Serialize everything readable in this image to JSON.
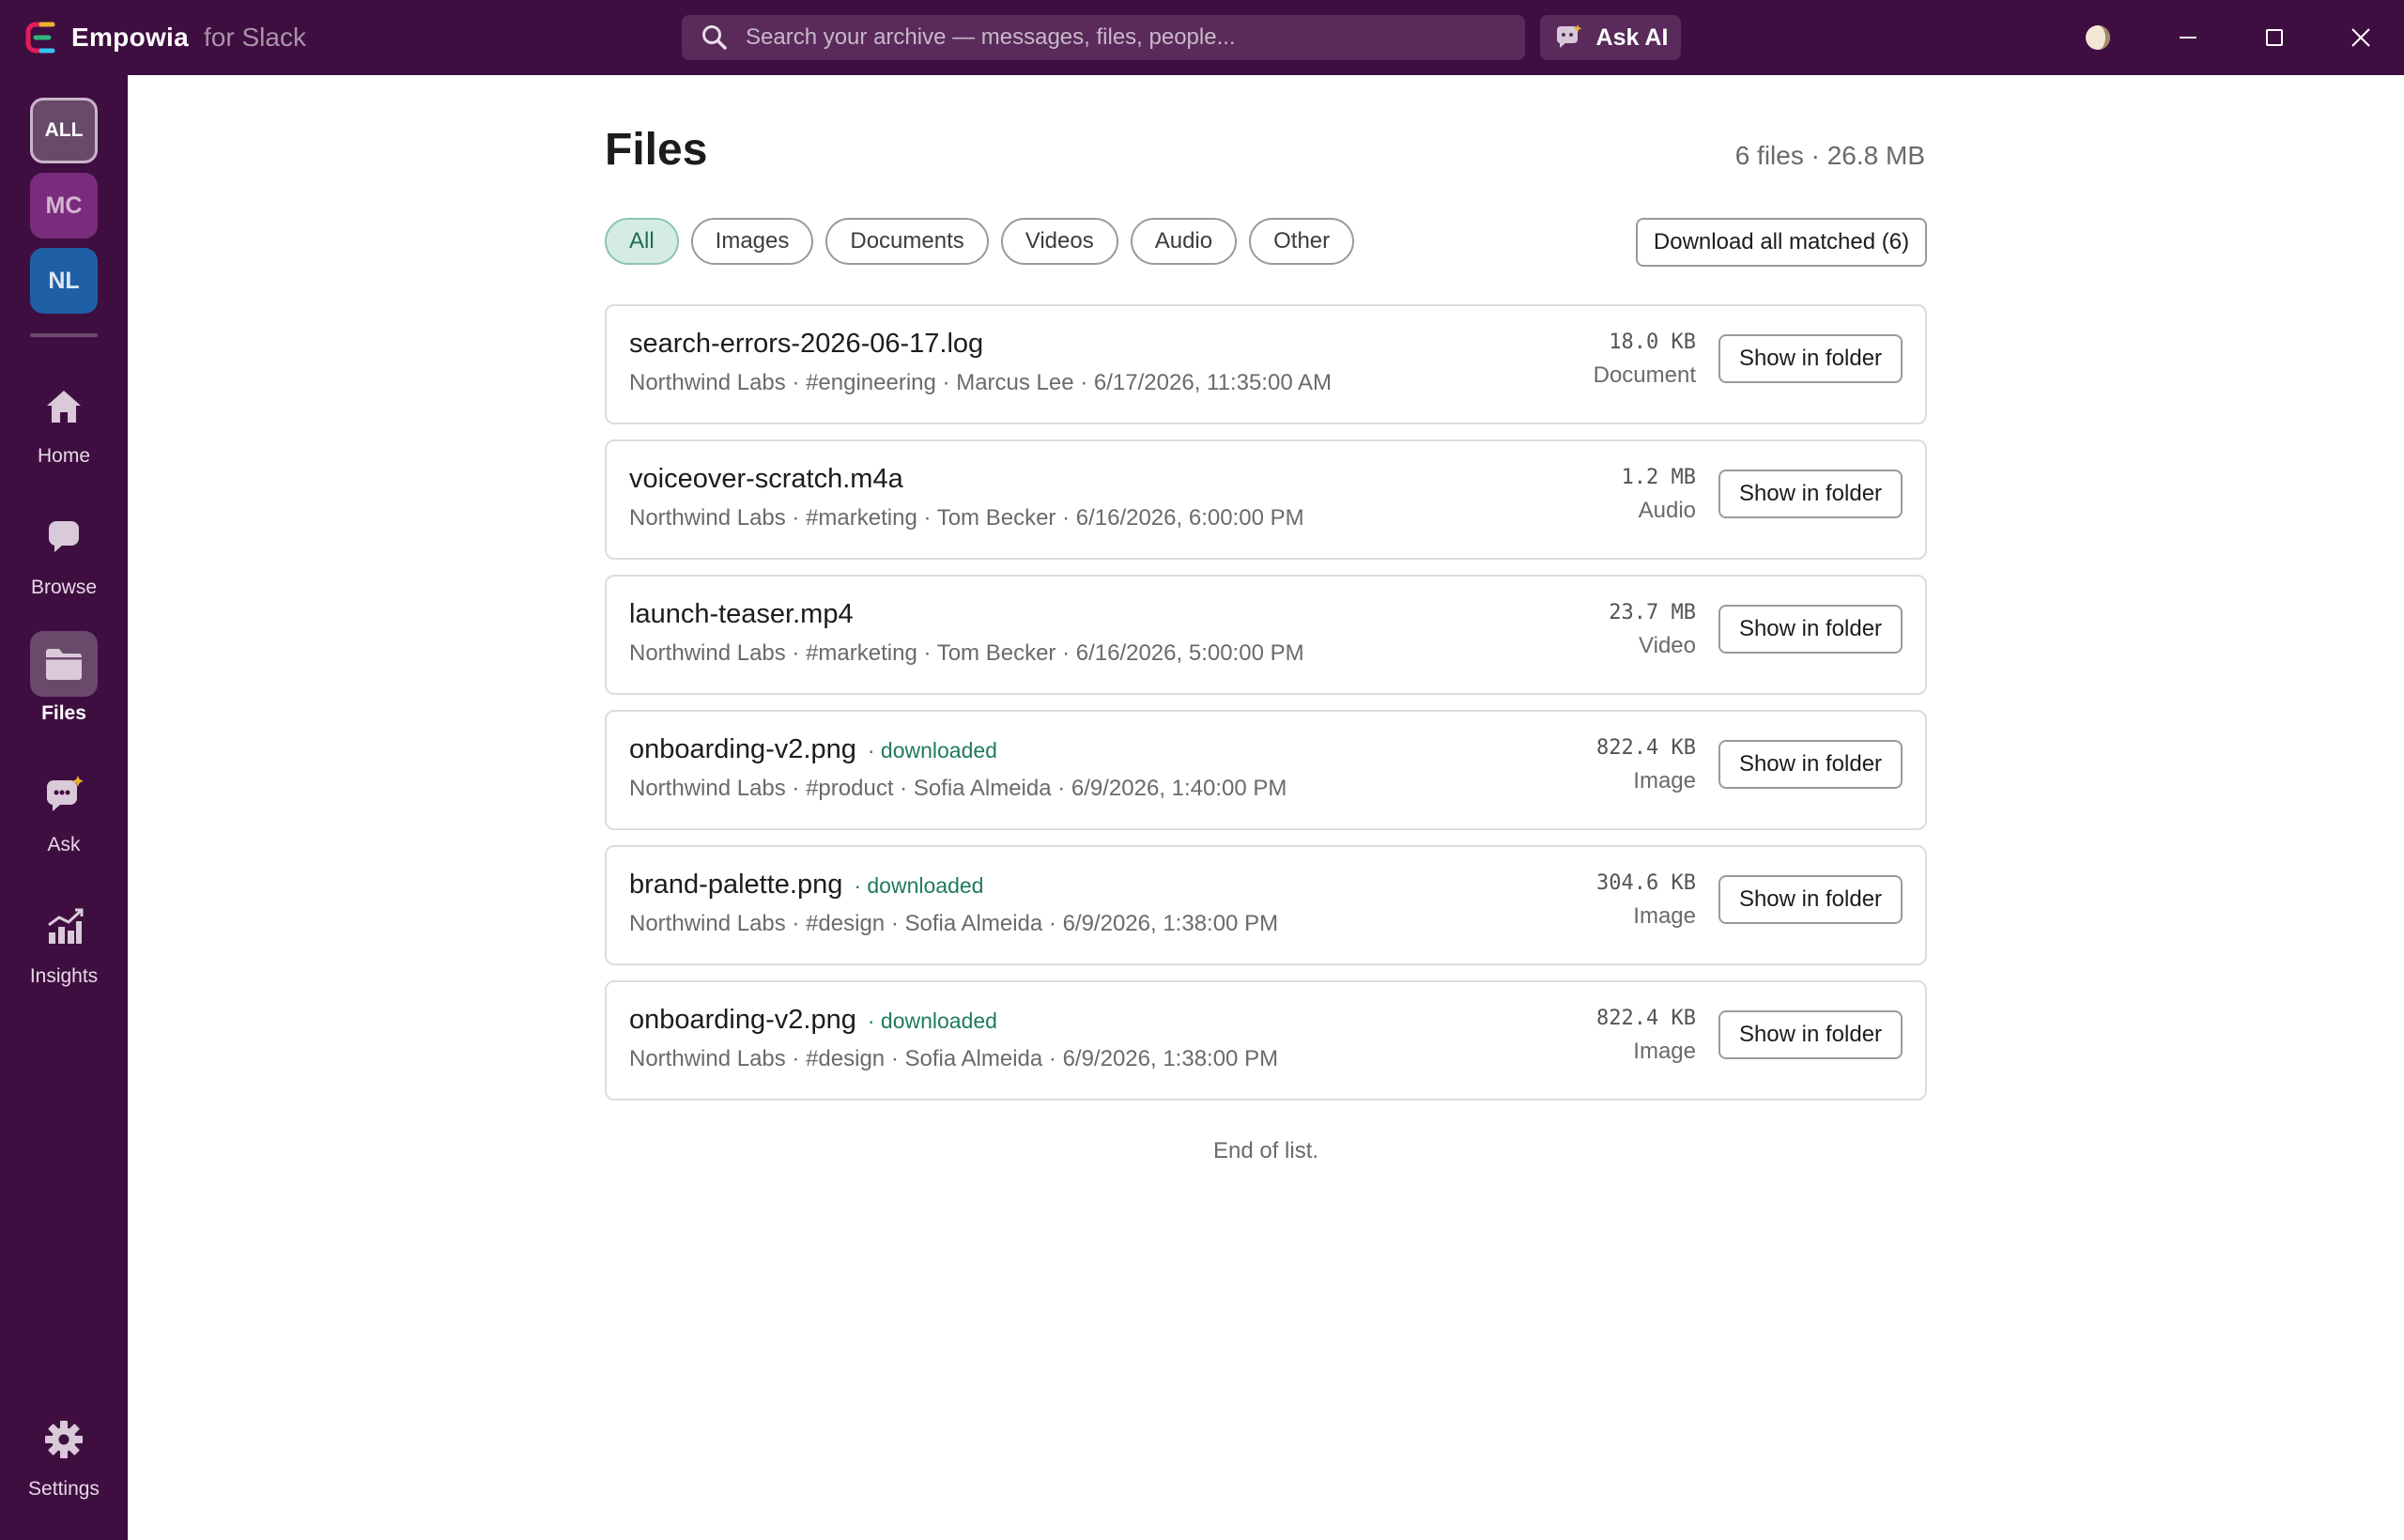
{
  "app": {
    "name": "Empowia",
    "subtitle": "for Slack",
    "brand_colors": [
      "#e01e5a",
      "#ecb22e",
      "#2eb67d",
      "#36c5f0"
    ]
  },
  "search": {
    "placeholder": "Search your archive — messages, files, people..."
  },
  "ask_ai": {
    "label": "Ask AI"
  },
  "window_controls": [
    "theme-toggle-icon",
    "minimize-icon",
    "maximize-icon",
    "close-icon"
  ],
  "workspaces": [
    {
      "label": "ALL",
      "selected": true
    },
    {
      "label": "MC",
      "selected": false
    },
    {
      "label": "NL",
      "selected": false
    }
  ],
  "nav": {
    "home": "Home",
    "browse": "Browse",
    "files": "Files",
    "ask": "Ask",
    "insights": "Insights",
    "settings": "Settings",
    "active": "Files"
  },
  "page": {
    "title": "Files",
    "summary": "6 files · 26.8 MB"
  },
  "filters": {
    "items": [
      "All",
      "Images",
      "Documents",
      "Videos",
      "Audio",
      "Other"
    ],
    "selected": "All"
  },
  "download_all_label": "Download all matched (6)",
  "files": [
    {
      "name": "search-errors-2026-06-17.log",
      "tag": "",
      "meta": "Northwind Labs · #engineering · Marcus Lee · 6/17/2026, 11:35:00 AM",
      "size": "18.0 KB",
      "type": "Document",
      "action": "Show in folder"
    },
    {
      "name": "voiceover-scratch.m4a",
      "tag": "",
      "meta": "Northwind Labs · #marketing · Tom Becker · 6/16/2026, 6:00:00 PM",
      "size": "1.2 MB",
      "type": "Audio",
      "action": "Show in folder"
    },
    {
      "name": "launch-teaser.mp4",
      "tag": "",
      "meta": "Northwind Labs · #marketing · Tom Becker · 6/16/2026, 5:00:00 PM",
      "size": "23.7 MB",
      "type": "Video",
      "action": "Show in folder"
    },
    {
      "name": "onboarding-v2.png",
      "tag": "· downloaded",
      "meta": "Northwind Labs · #product · Sofia Almeida · 6/9/2026, 1:40:00 PM",
      "size": "822.4 KB",
      "type": "Image",
      "action": "Show in folder"
    },
    {
      "name": "brand-palette.png",
      "tag": "· downloaded",
      "meta": "Northwind Labs · #design · Sofia Almeida · 6/9/2026, 1:38:00 PM",
      "size": "304.6 KB",
      "type": "Image",
      "action": "Show in folder"
    },
    {
      "name": "onboarding-v2.png",
      "tag": "· downloaded",
      "meta": "Northwind Labs · #design · Sofia Almeida · 6/9/2026, 1:38:00 PM",
      "size": "822.4 KB",
      "type": "Image",
      "action": "Show in folder"
    }
  ],
  "end_note": "End of list.",
  "colors": {
    "sidebar": "#3f0e40",
    "accent": "#1f7a5c",
    "chip_active_bg": "#d5ece5"
  }
}
